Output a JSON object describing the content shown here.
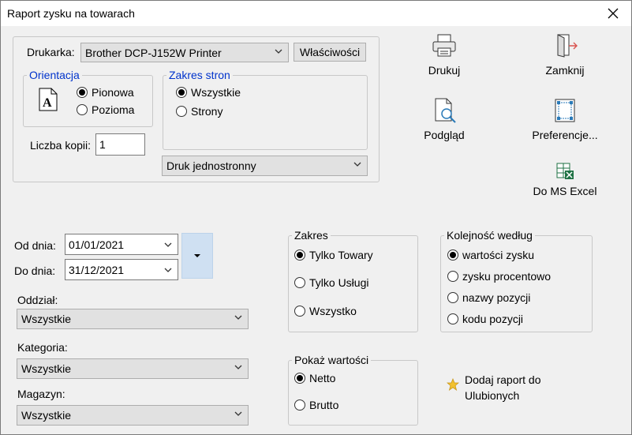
{
  "window": {
    "title": "Raport zysku na towarach"
  },
  "printer": {
    "label": "Drukarka:",
    "selected": "Brother DCP-J152W Printer",
    "properties_button": "Właściwości",
    "orientation": {
      "legend": "Orientacja",
      "portrait": "Pionowa",
      "landscape": "Pozioma",
      "selected": "portrait"
    },
    "page_range": {
      "legend": "Zakres stron",
      "all": "Wszystkie",
      "pages": "Strony",
      "selected": "all"
    },
    "copies_label": "Liczba kopii:",
    "copies_value": "1",
    "duplex_selected": "Druk jednostronny"
  },
  "tools": {
    "print": "Drukuj",
    "close": "Zamknij",
    "preview": "Podgląd",
    "preferences": "Preferencje...",
    "excel": "Do MS Excel"
  },
  "dates": {
    "from_label": "Od dnia:",
    "from_value": "01/01/2021",
    "to_label": "Do dnia:",
    "to_value": "31/12/2021"
  },
  "filters": {
    "branch_label": "Oddział:",
    "branch_value": "Wszystkie",
    "category_label": "Kategoria:",
    "category_value": "Wszystkie",
    "warehouse_label": "Magazyn:",
    "warehouse_value": "Wszystkie"
  },
  "scope": {
    "legend": "Zakres",
    "options": [
      "Tylko Towary",
      "Tylko Usługi",
      "Wszystko"
    ],
    "selected": 0
  },
  "order": {
    "legend": "Kolejność według",
    "options": [
      "wartości zysku",
      "zysku procentowo",
      "nazwy pozycji",
      "kodu pozycji"
    ],
    "selected": 0
  },
  "values": {
    "legend": "Pokaż wartości",
    "options": [
      "Netto",
      "Brutto"
    ],
    "selected": 0
  },
  "favorites": {
    "line1": "Dodaj raport do",
    "line2": "Ulubionych"
  }
}
